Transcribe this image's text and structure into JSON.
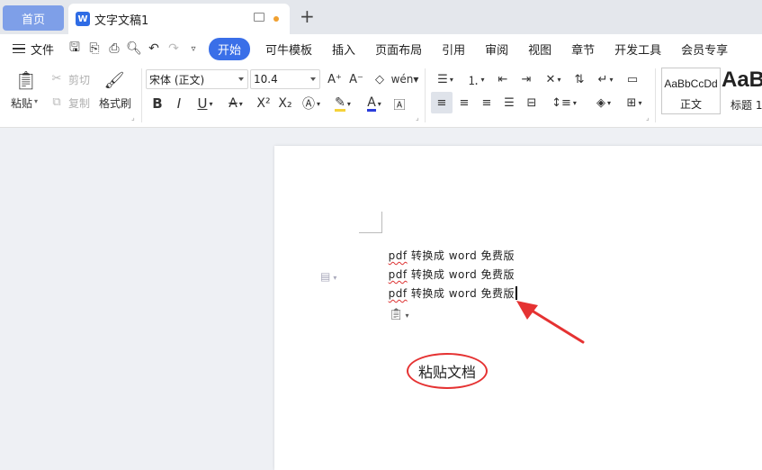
{
  "tabs": {
    "home": "首页",
    "document": "文字文稿1"
  },
  "menu": {
    "file": "文件",
    "items": [
      "开始",
      "可牛模板",
      "插入",
      "页面布局",
      "引用",
      "审阅",
      "视图",
      "章节",
      "开发工具",
      "会员专享"
    ],
    "active_index": 0
  },
  "ribbon": {
    "paste": "粘贴",
    "cut": "剪切",
    "copy": "复制",
    "format_painter": "格式刷",
    "font_name": "宋体 (正文)",
    "font_size": "10.4",
    "styles": [
      {
        "sample": "AaBbCcDd",
        "name": "正文"
      },
      {
        "sample": "AaB",
        "name": "标题 1"
      }
    ]
  },
  "document": {
    "lines": [
      {
        "pdf": "pdf",
        "rest": " 转换成 word 免费版"
      },
      {
        "pdf": "pdf",
        "rest": " 转换成 word 免费版"
      },
      {
        "pdf": "pdf",
        "rest": " 转换成 word 免费版"
      }
    ]
  },
  "annotation": {
    "label": "粘贴文档",
    "color": "#e53232"
  },
  "colors": {
    "accent": "#3a6fe8",
    "home_tab": "#7e9fe8",
    "highlight": "#f5d23a",
    "font_color": "#2a3cdb"
  }
}
